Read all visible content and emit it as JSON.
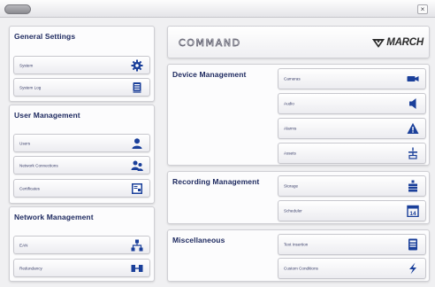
{
  "header": {
    "app_logo_text": "COMMAND",
    "brand_logo_text": "MARCH"
  },
  "colors": {
    "accent": "#1a3f9a",
    "title": "#1e2a60",
    "warning": "#1a3f9a"
  },
  "general_settings": {
    "title": "General Settings",
    "items": [
      {
        "label": "System",
        "icon": "gear-icon"
      },
      {
        "label": "System Log",
        "icon": "document-icon"
      }
    ]
  },
  "user_management": {
    "title": "User Management",
    "items": [
      {
        "label": "Users",
        "icon": "user-icon"
      },
      {
        "label": "Network Connections",
        "icon": "users-icon"
      },
      {
        "label": "Certificates",
        "icon": "certificate-icon"
      }
    ]
  },
  "network_management": {
    "title": "Network Management",
    "items": [
      {
        "label": "EAN",
        "icon": "network-icon"
      },
      {
        "label": "Redundancy",
        "icon": "redundancy-icon"
      }
    ]
  },
  "device_management": {
    "title": "Device Management",
    "items": [
      {
        "label": "Cameras",
        "icon": "camera-icon"
      },
      {
        "label": "Audio",
        "icon": "speaker-icon"
      },
      {
        "label": "Alarms",
        "icon": "warning-icon"
      },
      {
        "label": "Assets",
        "icon": "asset-icon"
      }
    ]
  },
  "recording_management": {
    "title": "Recording Management",
    "items": [
      {
        "label": "Storage",
        "icon": "storage-icon"
      },
      {
        "label": "Scheduler",
        "icon": "calendar-icon"
      }
    ]
  },
  "miscellaneous": {
    "title": "Miscellaneous",
    "items": [
      {
        "label": "Text Insertion",
        "icon": "text-insertion-icon"
      },
      {
        "label": "Custom Conditions",
        "icon": "lightning-icon"
      }
    ],
    "calendar_day": "14"
  }
}
